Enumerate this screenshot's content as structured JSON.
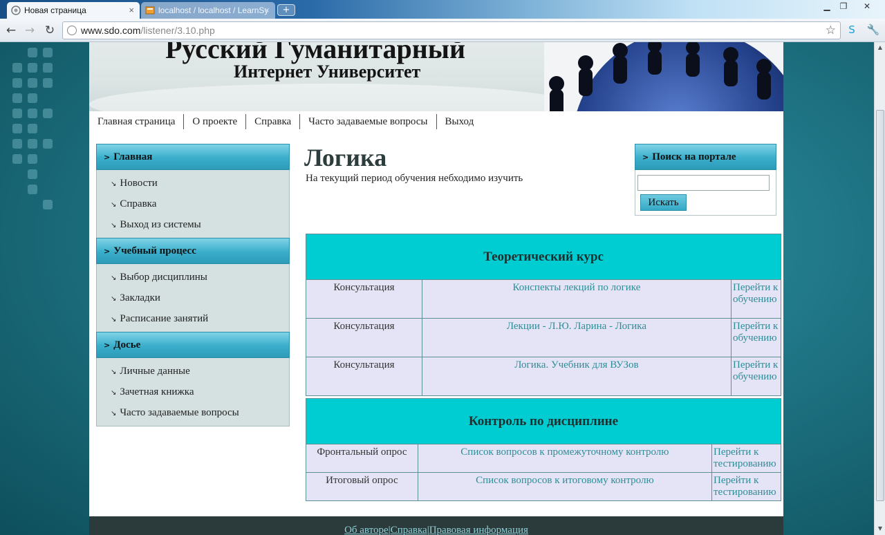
{
  "browser": {
    "tabs": [
      {
        "title": "Новая страница",
        "active": true
      },
      {
        "title": "localhost / localhost / LearnSy",
        "active": false
      }
    ],
    "url_host": "www.sdo.com",
    "url_path": "/listener/3.10.php",
    "new_tab_label": "+",
    "close_glyph": "×"
  },
  "site": {
    "title_line1": "Русский Гуманитарный",
    "title_line2": "Интернет Университет"
  },
  "topmenu": [
    "Главная страница",
    "О проекте",
    "Справка",
    "Часто задаваемые вопросы",
    "Выход"
  ],
  "sidebar": {
    "sections": [
      {
        "title": "Главная",
        "items": [
          "Новости",
          "Справка",
          "Выход из системы"
        ]
      },
      {
        "title": "Учебный процесс",
        "items": [
          "Выбор дисциплины",
          "Закладки",
          "Расписание занятий"
        ]
      },
      {
        "title": "Досье",
        "items": [
          "Личные данные",
          "Зачетная книжка",
          "Часто задаваемые вопросы"
        ]
      }
    ]
  },
  "main": {
    "title": "Логика",
    "subtitle": "На текущий период обучения небходимо изучить"
  },
  "search": {
    "title": "Поиск на портале",
    "value": "",
    "button": "Искать"
  },
  "theory": {
    "heading": "Теоретический курс",
    "rows": [
      {
        "kind": "Консультация",
        "material": "Конспекты лекций по логике",
        "action": "Перейти к обучению"
      },
      {
        "kind": "Консультация",
        "material": "Лекции - Л.Ю. Ларина - Логика",
        "action": "Перейти к обучению"
      },
      {
        "kind": "Консультация",
        "material": "Логика. Учебник для ВУЗов",
        "action": "Перейти к обучению"
      }
    ]
  },
  "control": {
    "heading": "Контроль по дисциплине",
    "rows": [
      {
        "kind": "Фронтальный опрос",
        "material": "Список вопросов к промежуточному контролю",
        "action": "Перейти к тестированию"
      },
      {
        "kind": "Итоговый опрос",
        "material": "Список вопросов к итоговому контролю",
        "action": "Перейти к тестированию"
      }
    ]
  },
  "footer": {
    "links": [
      "Об авторе",
      "Справка",
      "Правовая информация"
    ],
    "separator": "|"
  },
  "colors": {
    "accent_cyan": "#00cdd2",
    "header_gradient": "#39aecb",
    "link": "#2d8d97",
    "cell_bg": "#e4e4f6"
  },
  "icons": [
    "page-icon",
    "db-icon",
    "back-arrow-icon",
    "forward-arrow-icon",
    "reload-icon",
    "globe-icon",
    "star-icon",
    "skype-icon",
    "wrench-icon",
    "chevron-right-icon",
    "corner-arrow-icon"
  ]
}
